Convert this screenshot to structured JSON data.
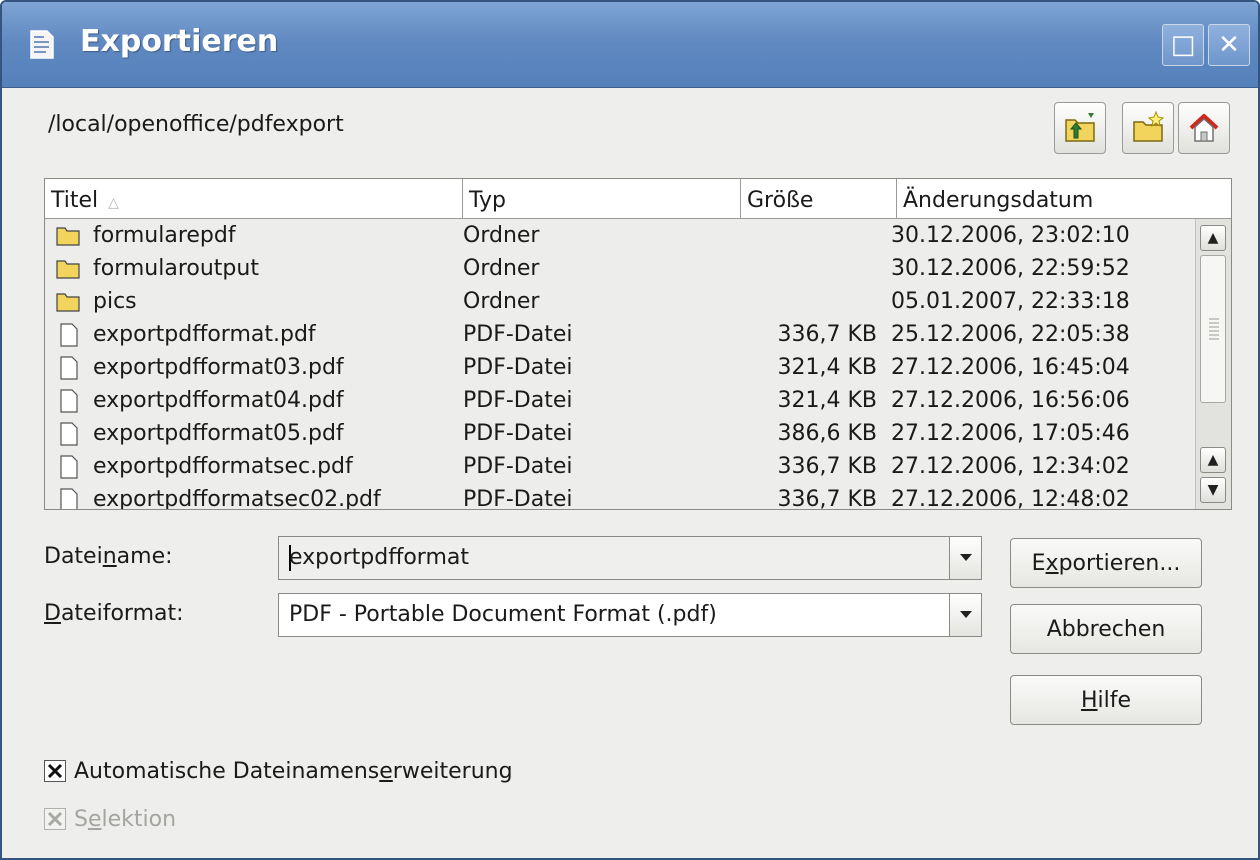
{
  "window": {
    "title": "Exportieren",
    "maximize_glyph": "□",
    "close_glyph": "✕"
  },
  "path": "/local/openoffice/pdfexport",
  "toolbar": {
    "buttons": [
      "folder-up-icon",
      "new-folder-icon",
      "home-icon"
    ]
  },
  "file_list": {
    "columns": [
      "Titel",
      "Typ",
      "Größe",
      "Änderungsdatum"
    ],
    "sort_indicator": "△",
    "rows": [
      {
        "icon": "folder-icon",
        "name": "formularepdf",
        "type": "Ordner",
        "size": "",
        "date": "30.12.2006, 23:02:10"
      },
      {
        "icon": "folder-icon",
        "name": "formularoutput",
        "type": "Ordner",
        "size": "",
        "date": "30.12.2006, 22:59:52"
      },
      {
        "icon": "folder-icon",
        "name": "pics",
        "type": "Ordner",
        "size": "",
        "date": "05.01.2007, 22:33:18"
      },
      {
        "icon": "file-icon",
        "name": "exportpdfformat.pdf",
        "type": "PDF-Datei",
        "size": "336,7 KB",
        "date": "25.12.2006, 22:05:38"
      },
      {
        "icon": "file-icon",
        "name": "exportpdfformat03.pdf",
        "type": "PDF-Datei",
        "size": "321,4 KB",
        "date": "27.12.2006, 16:45:04"
      },
      {
        "icon": "file-icon",
        "name": "exportpdfformat04.pdf",
        "type": "PDF-Datei",
        "size": "321,4 KB",
        "date": "27.12.2006, 16:56:06"
      },
      {
        "icon": "file-icon",
        "name": "exportpdfformat05.pdf",
        "type": "PDF-Datei",
        "size": "386,6 KB",
        "date": "27.12.2006, 17:05:46"
      },
      {
        "icon": "file-icon",
        "name": "exportpdfformatsec.pdf",
        "type": "PDF-Datei",
        "size": "336,7 KB",
        "date": "27.12.2006, 12:34:02"
      },
      {
        "icon": "file-icon",
        "name": "exportpdfformatsec02.pdf",
        "type": "PDF-Datei",
        "size": "336,7 KB",
        "date": "27.12.2006, 12:48:02"
      }
    ],
    "scrollbar": {
      "up_glyph": "▲",
      "down_glyph": "▼"
    }
  },
  "form": {
    "filename_label_pre": "Datei",
    "filename_label_u": "n",
    "filename_label_post": "ame:",
    "filename_value": "exportpdfformat",
    "format_label_u": "D",
    "format_label_post": "ateiformat:",
    "format_value": "PDF - Portable Document Format (.pdf)"
  },
  "buttons": {
    "export_pre": "E",
    "export_u": "x",
    "export_post": "portieren...",
    "cancel": "Abbrechen",
    "help_u": "H",
    "help_post": "ilfe"
  },
  "options": {
    "auto_ext_pre": "Automatische Dateinamens",
    "auto_ext_u": "e",
    "auto_ext_post": "rweiterung",
    "auto_ext_checked": true,
    "selection_pre": "S",
    "selection_u": "e",
    "selection_post": "lektion",
    "selection_checked": true,
    "selection_enabled": false
  },
  "colors": {
    "titlebar": "#5f88c0",
    "folder": "#f2d45c",
    "home_roof": "#d0281c"
  }
}
